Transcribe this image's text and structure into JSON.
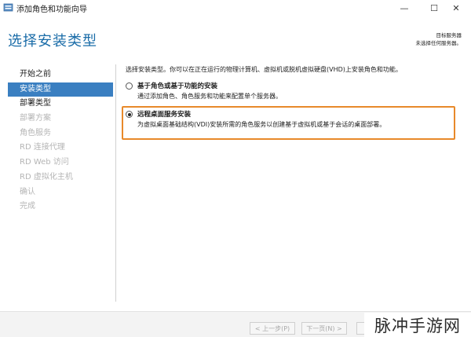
{
  "window": {
    "title": "添加角色和功能向导",
    "minimize_glyph": "—",
    "maximize_glyph": "☐",
    "close_glyph": "✕"
  },
  "header": {
    "title": "选择安装类型",
    "server_label": "目标服务器",
    "server_value": "未选择任何服务器。"
  },
  "sidebar": {
    "items": [
      {
        "label": "开始之前",
        "state": "normal"
      },
      {
        "label": "安装类型",
        "state": "selected"
      },
      {
        "label": "部署类型",
        "state": "normal"
      },
      {
        "label": "部署方案",
        "state": "disabled"
      },
      {
        "label": "角色服务",
        "state": "disabled"
      },
      {
        "label": "RD 连接代理",
        "state": "disabled"
      },
      {
        "label": "RD Web 访问",
        "state": "disabled"
      },
      {
        "label": "RD 虚拟化主机",
        "state": "disabled"
      },
      {
        "label": "确认",
        "state": "disabled"
      },
      {
        "label": "完成",
        "state": "disabled"
      }
    ]
  },
  "main": {
    "intro": "选择安装类型。你可以在正在运行的物理计算机、虚拟机或脱机虚拟硬盘(VHD)上安装角色和功能。",
    "options": [
      {
        "title": "基于角色或基于功能的安装",
        "description": "通过添加角色、角色服务和功能来配置单个服务器。",
        "selected": false
      },
      {
        "title": "远程桌面服务安装",
        "description": "为虚拟桌面基础结构(VDI)安装所需的角色服务以创建基于虚拟机或基于会话的桌面部署。",
        "selected": true
      }
    ]
  },
  "footer": {
    "prev_label": "< 上一步(P)",
    "next_label": "下一页(N) >",
    "extra_label": ""
  },
  "watermark": {
    "text": "脉冲手游网"
  },
  "colors": {
    "accent_blue": "#1a6ca8",
    "selected_bg": "#3a7fc1",
    "highlight_orange": "#e8892a",
    "disabled_text": "#b5b5b5"
  }
}
